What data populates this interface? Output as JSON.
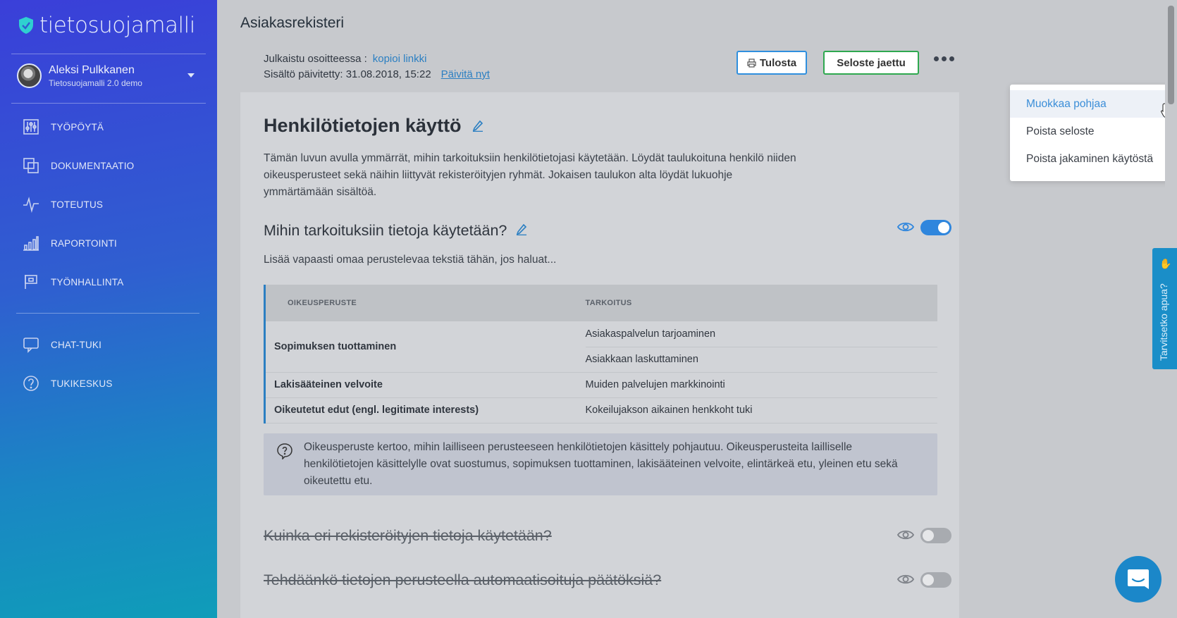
{
  "app": {
    "logo_text": "tietosuojamalli"
  },
  "user": {
    "name": "Aleksi Pulkkanen",
    "org": "Tietosuojamalli 2.0 demo"
  },
  "nav": {
    "primary": [
      "TYÖPÖYTÄ",
      "DOKUMENTAATIO",
      "TOTEUTUS",
      "RAPORTOINTI",
      "TYÖNHALLINTA"
    ],
    "secondary": [
      "CHAT-TUKI",
      "TUKIKESKUS"
    ]
  },
  "header": {
    "title": "Asiakasrekisteri",
    "published_label": "Julkaistu osoitteessa :",
    "copy_link": "kopioi linkki",
    "updated_label": "Sisältö päivitetty: 31.08.2018, 15:22",
    "update_now": "Päivitä nyt",
    "print_button": "Tulosta",
    "shared_button": "Seloste jaettu"
  },
  "dropdown": {
    "items": [
      "Muokkaa pohjaa",
      "Poista seloste",
      "Poista jakaminen käytöstä"
    ],
    "active_index": 0
  },
  "section": {
    "title": "Henkilötietojen käyttö",
    "intro": "Tämän luvun avulla ymmärrät, mihin tarkoituksiin henkilötietojasi käytetään. Löydät taulukoituna henkilö niiden oikeusperusteet sekä näihin liittyvät rekisteröityjen ryhmät. Jokaisen taulukon alta löydät lukuohje ymmärtämään sisältöä.",
    "subtitle": "Mihin tarkoituksiin tietoja käytetään?",
    "subtitle_visible": true,
    "free_text": "Lisää vapaasti omaa perustelevaa tekstiä tähän, jos haluat...",
    "table": {
      "headers": [
        "OIKEUSPERUSTE",
        "TARKOITUS"
      ],
      "rows": [
        {
          "basis": "Sopimuksen tuottaminen",
          "purposes": [
            "Asiakaspalvelun tarjoaminen",
            "Asiakkaan laskuttaminen"
          ]
        },
        {
          "basis": "Lakisääteinen velvoite",
          "purposes": [
            "Muiden palvelujen markkinointi"
          ]
        },
        {
          "basis": "Oikeutetut edut (engl. legitimate interests)",
          "purposes": [
            "Kokeilujakson aikainen henkkoht tuki"
          ]
        }
      ]
    },
    "info": "Oikeusperuste kertoo, mihin lailliseen perusteeseen henkilötietojen käsittely pohjautuu. Oikeusperusteita lailliselle henkilötietojen käsittelylle ovat suostumus, sopimuksen tuottaminen, lakisääteinen velvoite, elintärkeä etu, yleinen etu sekä oikeutettu etu.",
    "hidden_sections": [
      {
        "title": "Kuinka eri rekisteröityjen tietoja käytetään?",
        "visible": false
      },
      {
        "title": "Tehdäänkö tietojen perusteella automaatisoituja päätöksiä?",
        "visible": false
      }
    ]
  },
  "help_tab": "Tarvitsetko apua?",
  "colors": {
    "accent": "#2b7fc2",
    "success": "#2ea84f",
    "toggle_on": "#2f86dd"
  }
}
